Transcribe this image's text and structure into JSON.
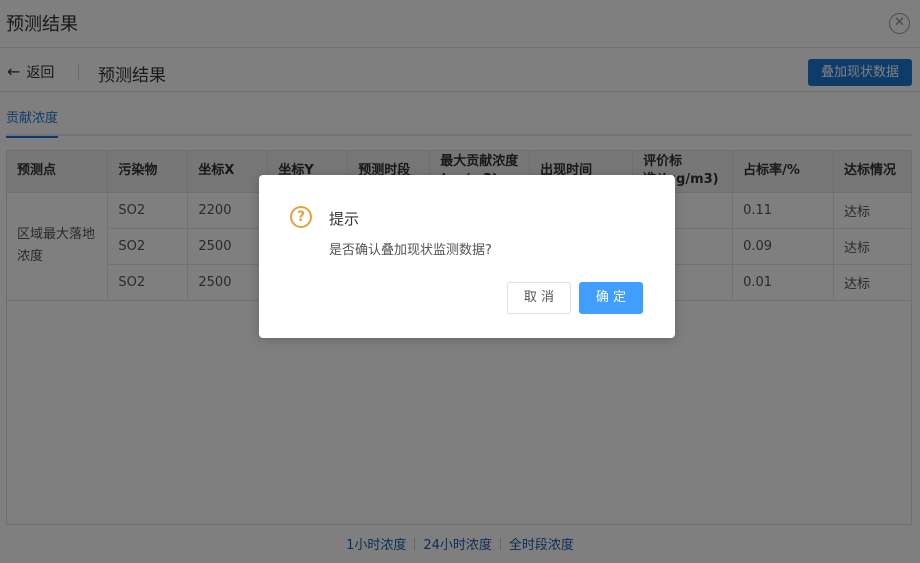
{
  "window": {
    "title": "预测结果",
    "close_icon": "close-circle-icon"
  },
  "header": {
    "back_label": "返回",
    "back_icon": "arrow-left-icon",
    "title": "预测结果",
    "overlay_button": "叠加现状数据"
  },
  "tabs": [
    {
      "label": "贡献浓度",
      "active": true
    }
  ],
  "table": {
    "columns": [
      "预测点",
      "污染物",
      "坐标X",
      "坐标Y",
      "预测时段",
      "最大贡献浓度(ug/m3)",
      "出现时间",
      "评价标准/(ug/m3)",
      "占标率/%",
      "达标情况"
    ],
    "merged_label": "区域最大落地浓度",
    "rows": [
      {
        "pollutant": "SO2",
        "x": "2200",
        "ratio": "0.11",
        "status": "达标"
      },
      {
        "pollutant": "SO2",
        "x": "2500",
        "ratio": "0.09",
        "status": "达标"
      },
      {
        "pollutant": "SO2",
        "x": "2500",
        "ratio": "0.01",
        "status": "达标"
      }
    ]
  },
  "footer": {
    "links": [
      "1小时浓度",
      "24小时浓度",
      "全时段浓度"
    ]
  },
  "dialog": {
    "icon": "question-icon",
    "title": "提示",
    "message": "是否确认叠加现状监测数据?",
    "cancel": "取 消",
    "confirm": "确 定"
  },
  "colors": {
    "primary": "#1a78d6",
    "confirm": "#409eff",
    "warning": "#e6a23c"
  }
}
